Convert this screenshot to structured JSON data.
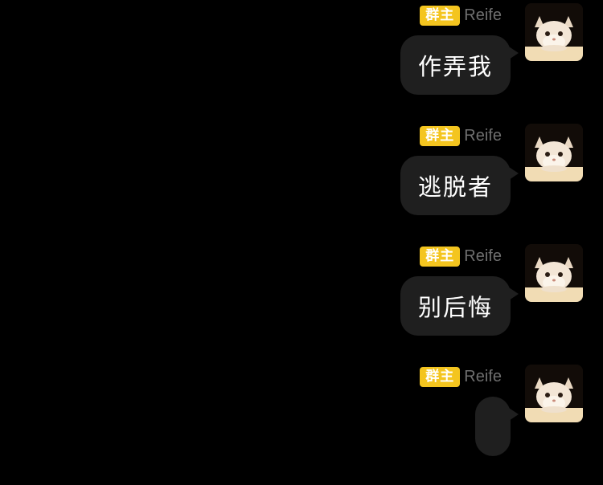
{
  "messages": [
    {
      "role_badge": "群主",
      "sender": "Reife",
      "text": "作弄我",
      "avatar": "cat-avatar"
    },
    {
      "role_badge": "群主",
      "sender": "Reife",
      "text": "逃脱者",
      "avatar": "cat-avatar"
    },
    {
      "role_badge": "群主",
      "sender": "Reife",
      "text": "别后悔",
      "avatar": "cat-avatar"
    },
    {
      "role_badge": "群主",
      "sender": "Reife",
      "text": "",
      "avatar": "cat-avatar"
    }
  ],
  "colors": {
    "background": "#000000",
    "badge": "#f4c51f",
    "bubble": "#1f1f1f",
    "sender_name": "#6f6f6f"
  }
}
